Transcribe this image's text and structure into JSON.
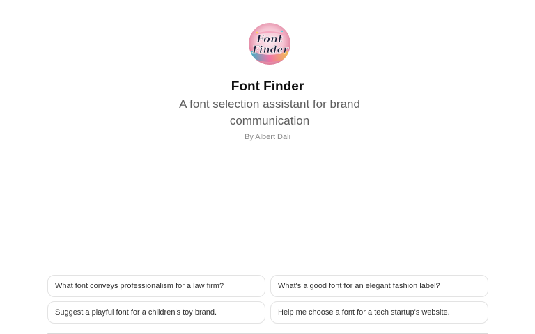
{
  "gpt": {
    "title": "Font Finder",
    "description": "A font selection assistant for brand communication",
    "author": "By Albert Dali",
    "avatar_logo_text": "Font Finder"
  },
  "starter_prompts": [
    "What font conveys professionalism for a law firm?",
    "What's a good font for an elegant fashion label?",
    "Suggest a playful font for a children's toy brand.",
    "Help me choose a font for a tech startup's website."
  ],
  "colors": {
    "title": "#0d0d0d",
    "description": "#5d5d5d",
    "author": "#8a8a8a",
    "prompt_border": "#e3e3e3"
  }
}
